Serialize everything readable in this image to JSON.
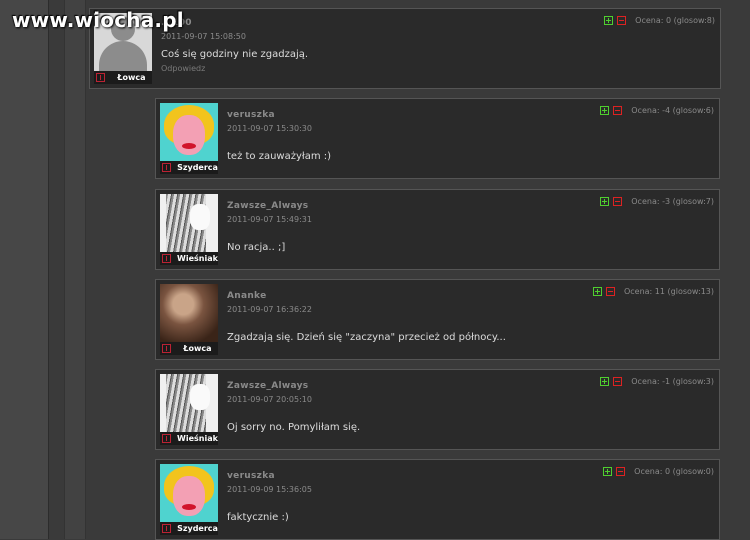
{
  "site": {
    "watermark": "www.wiocha.pl"
  },
  "comments": [
    {
      "username": "...100",
      "date": "2011-09-07 15:08:50",
      "text": "Coś się godziny nie zgadzają.",
      "reply": "Odpowiedz",
      "rank": "Łowca",
      "score": "Ocena: 0 (glosow:8)",
      "avatar": "default-silhouette"
    },
    {
      "username": "veruszka",
      "date": "2011-09-07 15:30:30",
      "text": "też to zauważyłam :)",
      "rank": "Szyderca",
      "score": "Ocena: -4 (glosow:6)",
      "avatar": "marilyn-portrait"
    },
    {
      "username": "Zawsze_Always",
      "date": "2011-09-07 15:49:31",
      "text": "No racja.. ;]",
      "rank": "Wieśniak",
      "score": "Ocena: -3 (glosow:7)",
      "avatar": "anime-girl"
    },
    {
      "username": "Ananke",
      "date": "2011-09-07 16:36:22",
      "text": "Zgadzają się. Dzień się \"zaczyna\" przecież od północy...",
      "rank": "Łowca",
      "score": "Ocena: 11 (glosow:13)",
      "avatar": "photo-portrait"
    },
    {
      "username": "Zawsze_Always",
      "date": "2011-09-07 20:05:10",
      "text": "Oj sorry no. Pomyliłam się.",
      "rank": "Wieśniak",
      "score": "Ocena: -1 (glosow:3)",
      "avatar": "anime-girl"
    },
    {
      "username": "veruszka",
      "date": "2011-09-09 15:36:05",
      "text": "faktycznie :)",
      "rank": "Szyderca",
      "score": "Ocena: 0 (glosow:0)",
      "avatar": "marilyn-portrait"
    }
  ]
}
